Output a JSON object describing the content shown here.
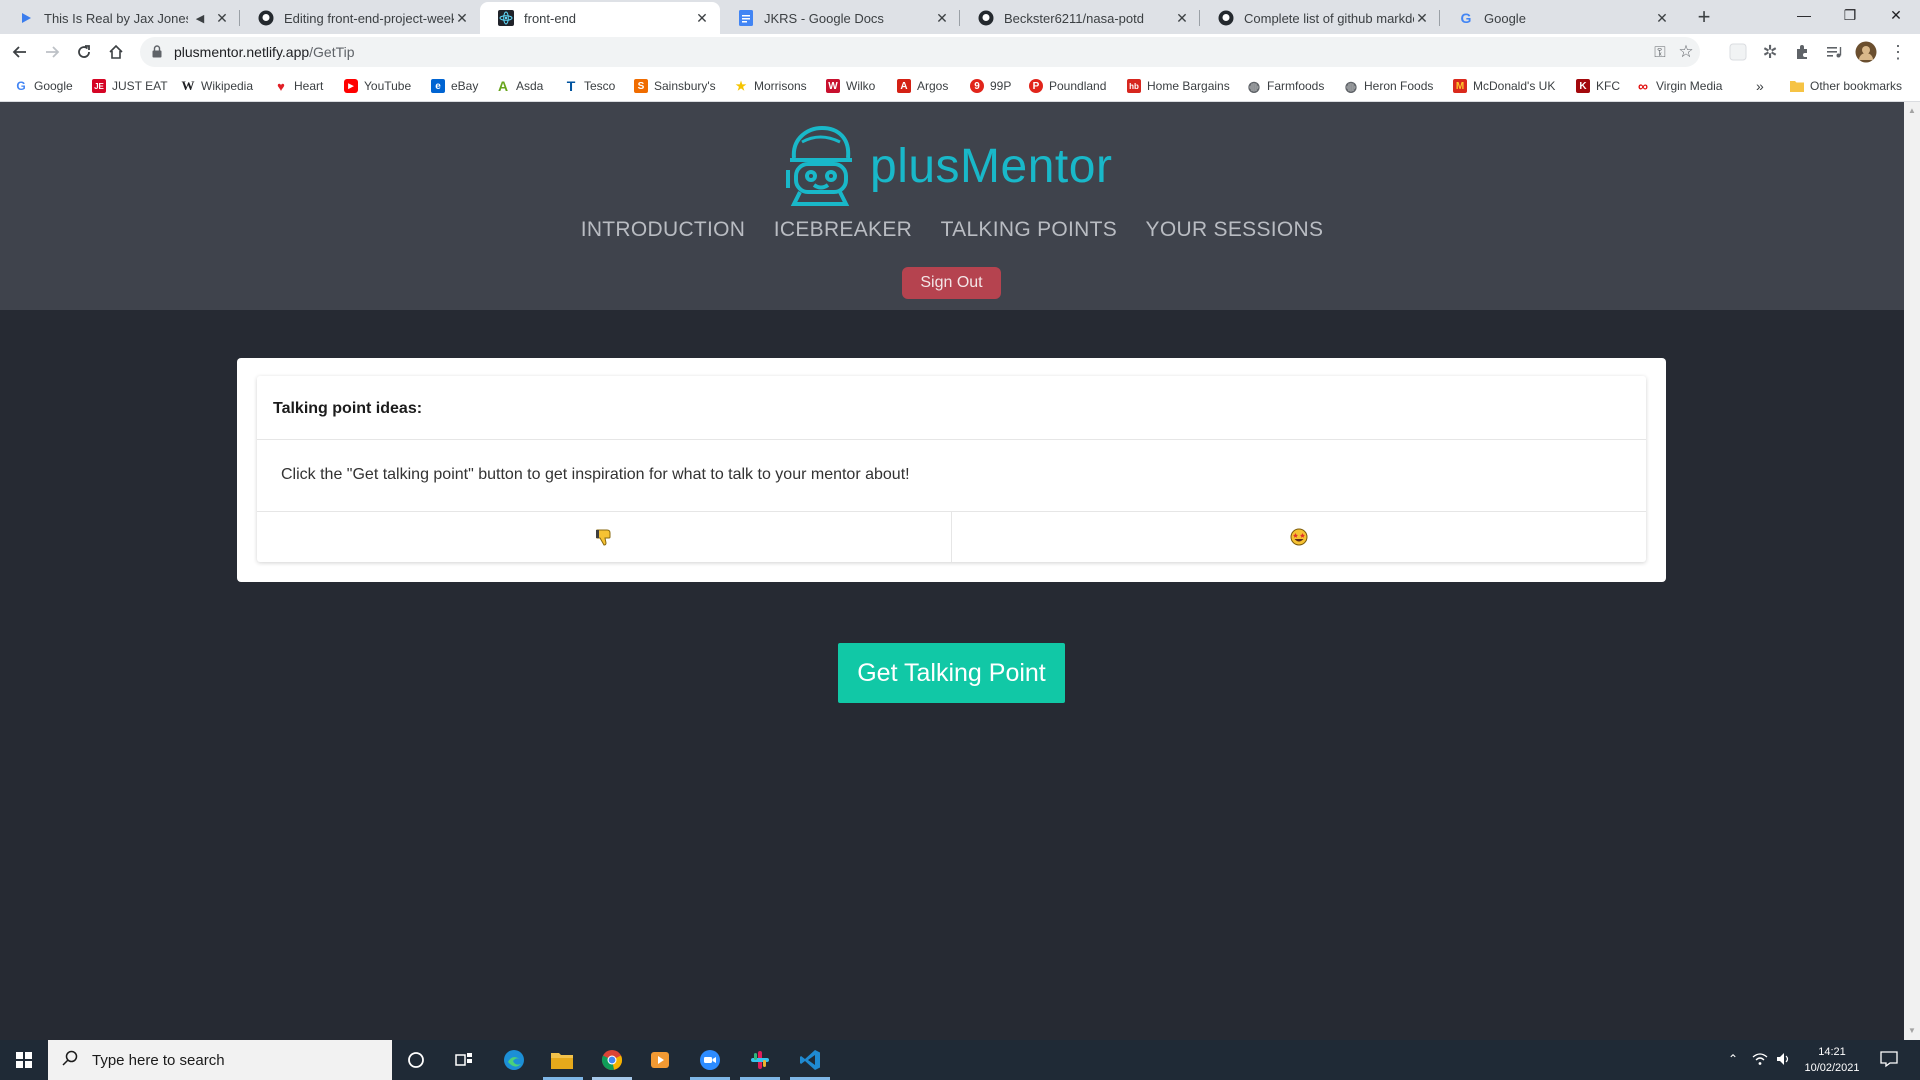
{
  "browser": {
    "tabs": [
      {
        "title": "This Is Real by Jax Jones Feat",
        "icon": "play-icon",
        "active": false
      },
      {
        "title": "Editing front-end-project-week-",
        "icon": "github-icon",
        "active": false
      },
      {
        "title": "front-end",
        "icon": "react-icon",
        "active": true
      },
      {
        "title": "JKRS - Google Docs",
        "icon": "docs-icon",
        "active": false
      },
      {
        "title": "Beckster6211/nasa-potd",
        "icon": "github-icon",
        "active": false
      },
      {
        "title": "Complete list of github markdow",
        "icon": "github-icon",
        "active": false
      },
      {
        "title": "Google",
        "icon": "google-icon",
        "active": false
      }
    ],
    "new_tab_label": "+",
    "url_host": "plusmentor.netlify.app",
    "url_path": "/GetTip",
    "bookmarks": [
      {
        "label": "Google",
        "color": "#4285f4",
        "glyph": "G"
      },
      {
        "label": "JUST EAT",
        "color": "#d50525",
        "glyph": "JE"
      },
      {
        "label": "Wikipedia",
        "color": "#202124",
        "glyph": "W"
      },
      {
        "label": "Heart",
        "color": "#e11f26",
        "glyph": "♥"
      },
      {
        "label": "YouTube",
        "color": "#ff0000",
        "glyph": "▶"
      },
      {
        "label": "eBay",
        "color": "#0064d2",
        "glyph": "e"
      },
      {
        "label": "Asda",
        "color": "#68a51c",
        "glyph": "A"
      },
      {
        "label": "Tesco",
        "color": "#00539f",
        "glyph": "T"
      },
      {
        "label": "Sainsbury's",
        "color": "#f06c00",
        "glyph": "S"
      },
      {
        "label": "Morrisons",
        "color": "#f5c400",
        "glyph": "★"
      },
      {
        "label": "Wilko",
        "color": "#c8102e",
        "glyph": "W"
      },
      {
        "label": "Argos",
        "color": "#d42114",
        "glyph": "A"
      },
      {
        "label": "99P",
        "color": "#e1251b",
        "glyph": "9"
      },
      {
        "label": "Poundland",
        "color": "#e1251b",
        "glyph": "P"
      },
      {
        "label": "Home Bargains",
        "color": "#d7261e",
        "glyph": "hb"
      },
      {
        "label": "Farmfoods",
        "color": "#5f6368",
        "glyph": "◍"
      },
      {
        "label": "Heron Foods",
        "color": "#5f6368",
        "glyph": "◍"
      },
      {
        "label": "McDonald's UK",
        "color": "#da291c",
        "glyph": "M"
      },
      {
        "label": "KFC",
        "color": "#a3080c",
        "glyph": "K"
      },
      {
        "label": "Virgin Media",
        "color": "#e10a0a",
        "glyph": "∞"
      }
    ],
    "more_bookmarks": "»",
    "other_bookmarks": "Other bookmarks"
  },
  "site": {
    "logo_text": "plusMentor",
    "nav": [
      "INTRODUCTION",
      "ICEBREAKER",
      "TALKING POINTS",
      "YOUR SESSIONS"
    ],
    "signout_label": "Sign Out",
    "card_title": "Talking point ideas:",
    "card_body": "Click the \"Get talking point\" button to get inspiration for what to talk to your mentor about!",
    "thumbs_down_emoji": "👎",
    "star_eyes_emoji": "🤩",
    "get_button_label": "Get Talking Point",
    "colors": {
      "accent": "#19b8c9",
      "button": "#11c8a6",
      "signout": "#b5434f",
      "header": "#3f434c",
      "page": "#262a33"
    }
  },
  "taskbar": {
    "search_placeholder": "Type here to search",
    "time": "14:21",
    "date": "10/02/2021",
    "apps": [
      "cortana-icon",
      "task-view-icon",
      "edge-icon",
      "file-explorer-icon",
      "chrome-icon",
      "media-player-icon",
      "zoom-icon",
      "slack-icon",
      "vscode-icon"
    ]
  }
}
